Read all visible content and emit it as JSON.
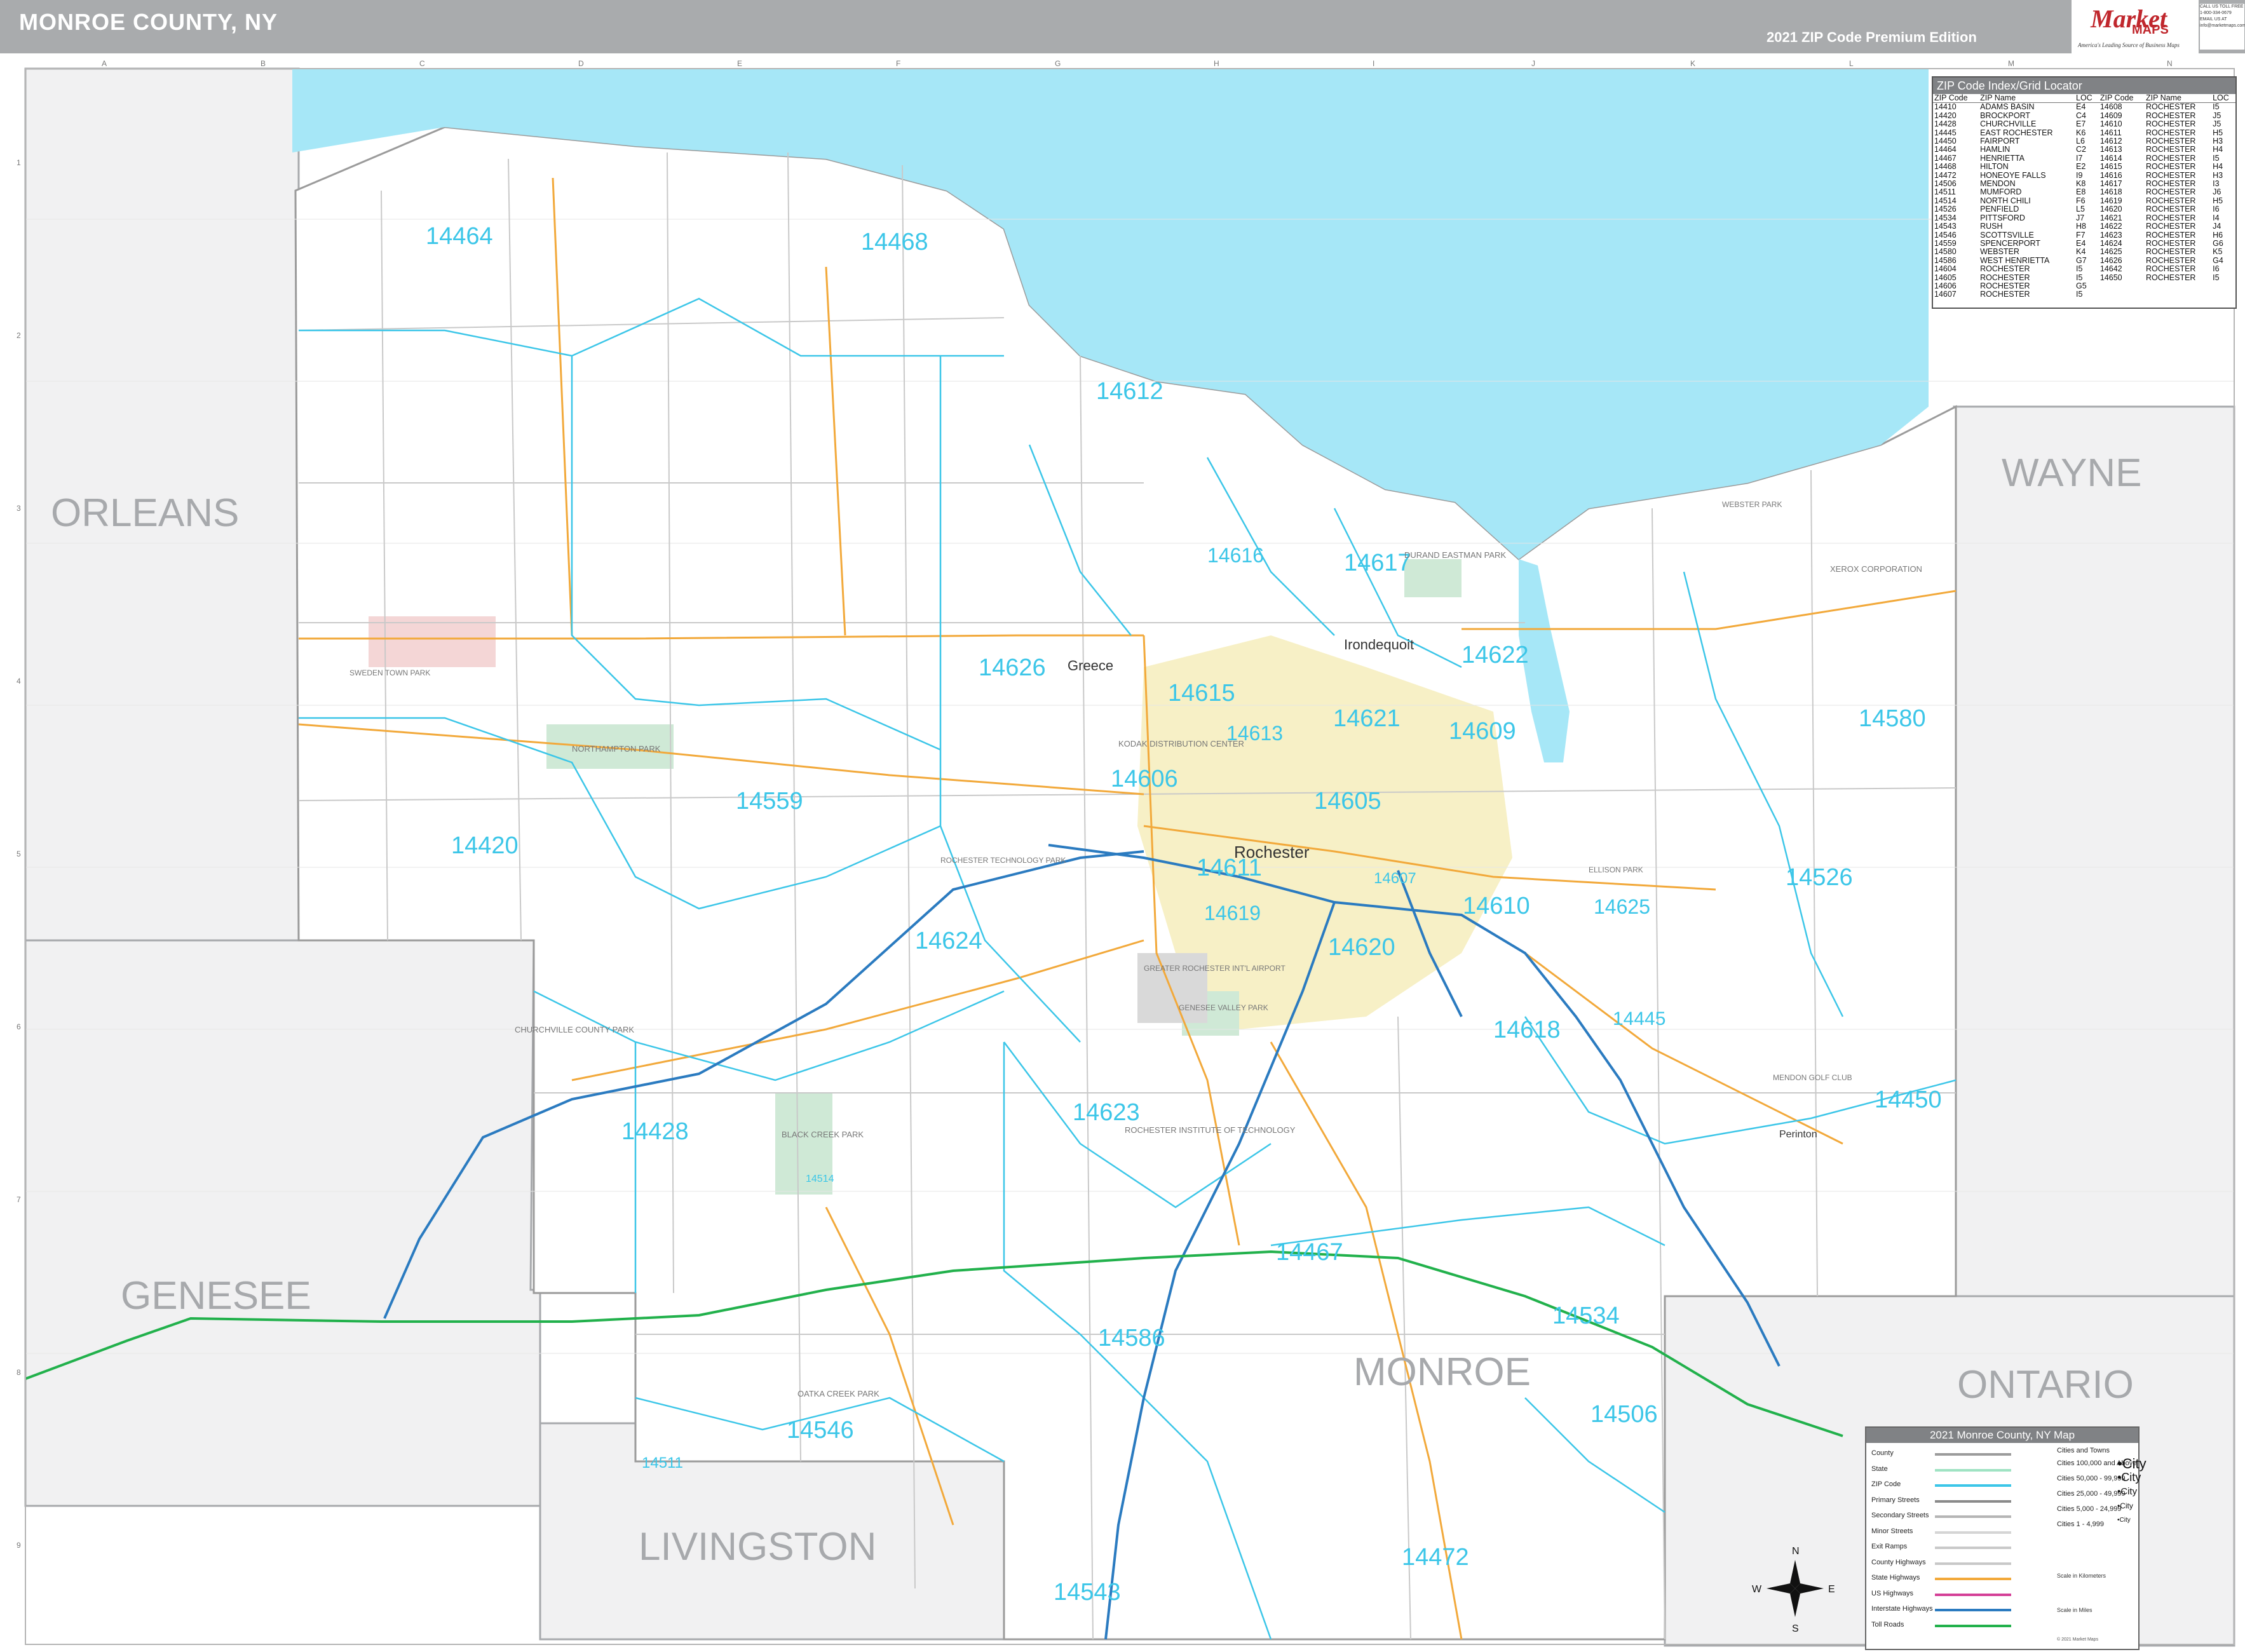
{
  "header": {
    "title": "MONROE COUNTY, NY",
    "edition": "2021 ZIP Code Premium Edition",
    "logo_main": "Market",
    "logo_sub": "MAPS",
    "logo_tagline": "America's Leading Source of Business Maps",
    "contact_lines": [
      "CALL US TOLL FREE",
      "1-800-334-0679",
      "EMAIL US AT",
      "info@marketmaps.com"
    ]
  },
  "colors": {
    "water": "#a6e7f7",
    "surrounding_county": "#f1f1f2",
    "county_land": "#ffffff",
    "zip_label": "#3cc6e8",
    "zip_boundary": "#3cc6e8",
    "county_label": "#a7a9ac",
    "interstate": "#2b7bc0",
    "toll_road": "#22b14c",
    "state_highway": "#f2a93b",
    "urban": "#f7f0c6",
    "park": "#cfe9d6"
  },
  "grid": {
    "columns": [
      "A",
      "B",
      "C",
      "D",
      "E",
      "F",
      "G",
      "H",
      "I",
      "J",
      "K",
      "L",
      "M",
      "N"
    ],
    "rows": [
      "1",
      "2",
      "3",
      "4",
      "5",
      "6",
      "7",
      "8",
      "9"
    ]
  },
  "counties": [
    {
      "name": "ORLEANS"
    },
    {
      "name": "WAYNE"
    },
    {
      "name": "GENESEE"
    },
    {
      "name": "MONROE"
    },
    {
      "name": "ONTARIO"
    },
    {
      "name": "LIVINGSTON"
    }
  ],
  "zips": [
    {
      "code": "14464"
    },
    {
      "code": "14468"
    },
    {
      "code": "14612"
    },
    {
      "code": "14616"
    },
    {
      "code": "14617"
    },
    {
      "code": "14626"
    },
    {
      "code": "14615"
    },
    {
      "code": "14621"
    },
    {
      "code": "14622"
    },
    {
      "code": "14613"
    },
    {
      "code": "14609"
    },
    {
      "code": "14580"
    },
    {
      "code": "14606"
    },
    {
      "code": "14605"
    },
    {
      "code": "14559"
    },
    {
      "code": "14420"
    },
    {
      "code": "14611"
    },
    {
      "code": "14607"
    },
    {
      "code": "14526"
    },
    {
      "code": "14619"
    },
    {
      "code": "14610"
    },
    {
      "code": "14625"
    },
    {
      "code": "14624"
    },
    {
      "code": "14620"
    },
    {
      "code": "14618"
    },
    {
      "code": "14445"
    },
    {
      "code": "14428"
    },
    {
      "code": "14623"
    },
    {
      "code": "14450"
    },
    {
      "code": "14514"
    },
    {
      "code": "14467"
    },
    {
      "code": "14534"
    },
    {
      "code": "14586"
    },
    {
      "code": "14506"
    },
    {
      "code": "14546"
    },
    {
      "code": "14511"
    },
    {
      "code": "14472"
    },
    {
      "code": "14543"
    }
  ],
  "places": [
    {
      "name": "Greece"
    },
    {
      "name": "Irondequoit"
    },
    {
      "name": "Rochester"
    },
    {
      "name": "Perinton"
    },
    {
      "name": "XEROX CORPORATION"
    },
    {
      "name": "DURAND EASTMAN PARK"
    },
    {
      "name": "KODAK DISTRIBUTION CENTER"
    },
    {
      "name": "NORTHAMPTON PARK"
    },
    {
      "name": "CHURCHVILLE COUNTY PARK"
    },
    {
      "name": "BLACK CREEK PARK"
    },
    {
      "name": "ROCHESTER INSTITUTE OF TECHNOLOGY"
    },
    {
      "name": "GREATER ROCHESTER INT'L AIRPORT"
    },
    {
      "name": "OATKA CREEK PARK"
    },
    {
      "name": "GENESEE VALLEY PARK"
    },
    {
      "name": "ELLISON PARK"
    },
    {
      "name": "MENDON GOLF CLUB"
    },
    {
      "name": "WEBSTER PARK"
    },
    {
      "name": "ROCHESTER TECHNOLOGY PARK"
    },
    {
      "name": "SWEDEN TOWN PARK"
    }
  ],
  "zip_index": {
    "title": "ZIP Code Index/Grid Locator",
    "headers": [
      "ZIP Code",
      "ZIP Name",
      "LOC",
      "ZIP Code",
      "ZIP Name",
      "LOC"
    ],
    "rows": [
      [
        "14410",
        "ADAMS BASIN",
        "E4",
        "14608",
        "ROCHESTER",
        "I5"
      ],
      [
        "14420",
        "BROCKPORT",
        "C4",
        "14609",
        "ROCHESTER",
        "J5"
      ],
      [
        "14428",
        "CHURCHVILLE",
        "E7",
        "14610",
        "ROCHESTER",
        "J5"
      ],
      [
        "14445",
        "EAST ROCHESTER",
        "K6",
        "14611",
        "ROCHESTER",
        "H5"
      ],
      [
        "14450",
        "FAIRPORT",
        "L6",
        "14612",
        "ROCHESTER",
        "H3"
      ],
      [
        "14464",
        "HAMLIN",
        "C2",
        "14613",
        "ROCHESTER",
        "H4"
      ],
      [
        "14467",
        "HENRIETTA",
        "I7",
        "14614",
        "ROCHESTER",
        "I5"
      ],
      [
        "14468",
        "HILTON",
        "E2",
        "14615",
        "ROCHESTER",
        "H4"
      ],
      [
        "14472",
        "HONEOYE FALLS",
        "I9",
        "14616",
        "ROCHESTER",
        "H3"
      ],
      [
        "14506",
        "MENDON",
        "K8",
        "14617",
        "ROCHESTER",
        "I3"
      ],
      [
        "14511",
        "MUMFORD",
        "E8",
        "14618",
        "ROCHESTER",
        "J6"
      ],
      [
        "14514",
        "NORTH CHILI",
        "F6",
        "14619",
        "ROCHESTER",
        "H5"
      ],
      [
        "14526",
        "PENFIELD",
        "L5",
        "14620",
        "ROCHESTER",
        "I6"
      ],
      [
        "14534",
        "PITTSFORD",
        "J7",
        "14621",
        "ROCHESTER",
        "I4"
      ],
      [
        "14543",
        "RUSH",
        "H8",
        "14622",
        "ROCHESTER",
        "J4"
      ],
      [
        "14546",
        "SCOTTSVILLE",
        "F7",
        "14623",
        "ROCHESTER",
        "H6"
      ],
      [
        "14559",
        "SPENCERPORT",
        "E4",
        "14624",
        "ROCHESTER",
        "G6"
      ],
      [
        "14580",
        "WEBSTER",
        "K4",
        "14625",
        "ROCHESTER",
        "K5"
      ],
      [
        "14586",
        "WEST HENRIETTA",
        "G7",
        "14626",
        "ROCHESTER",
        "G4"
      ],
      [
        "14604",
        "ROCHESTER",
        "I5",
        "14642",
        "ROCHESTER",
        "I6"
      ],
      [
        "14605",
        "ROCHESTER",
        "I5",
        "14650",
        "ROCHESTER",
        "I5"
      ],
      [
        "14606",
        "ROCHESTER",
        "G5",
        "",
        "",
        ""
      ],
      [
        "14607",
        "ROCHESTER",
        "I5",
        "",
        "",
        ""
      ]
    ]
  },
  "legend": {
    "title": "2021 Monroe County, NY Map",
    "items": [
      {
        "label": "County",
        "color": "#9b9b9b"
      },
      {
        "label": "State",
        "color": "#9fe3c3"
      },
      {
        "label": "ZIP Code",
        "color": "#3cc6e8"
      },
      {
        "label": "Primary Streets",
        "color": "#8a8a8a"
      },
      {
        "label": "Secondary Streets",
        "color": "#b5b5b5"
      },
      {
        "label": "Minor Streets",
        "color": "#d5d5d5"
      },
      {
        "label": "Exit Ramps",
        "color": "#c9c9c9"
      },
      {
        "label": "County Highways",
        "color": "#c8c8c8"
      },
      {
        "label": "State Highways",
        "color": "#f2a93b"
      },
      {
        "label": "US Highways",
        "color": "#d43f97"
      },
      {
        "label": "Interstate Highways",
        "color": "#2b7bc0"
      },
      {
        "label": "Toll Roads",
        "color": "#22b14c"
      }
    ],
    "cities_heading": "Cities and Towns",
    "cities": [
      {
        "label": "Cities 100,000 and Above",
        "sample": "•City"
      },
      {
        "label": "Cities 50,000 - 99,999",
        "sample": "•City"
      },
      {
        "label": "Cities 25,000 - 49,999",
        "sample": "•City"
      },
      {
        "label": "Cities 5,000 - 24,999",
        "sample": "•City"
      },
      {
        "label": "Cities 1 - 4,999",
        "sample": "•City"
      }
    ],
    "scale_km": "Scale in Kilometers",
    "scale_mi": "Scale in Miles",
    "copyright": "© 2021 Market Maps"
  },
  "compass": {
    "n": "N",
    "s": "S",
    "e": "E",
    "w": "W"
  }
}
